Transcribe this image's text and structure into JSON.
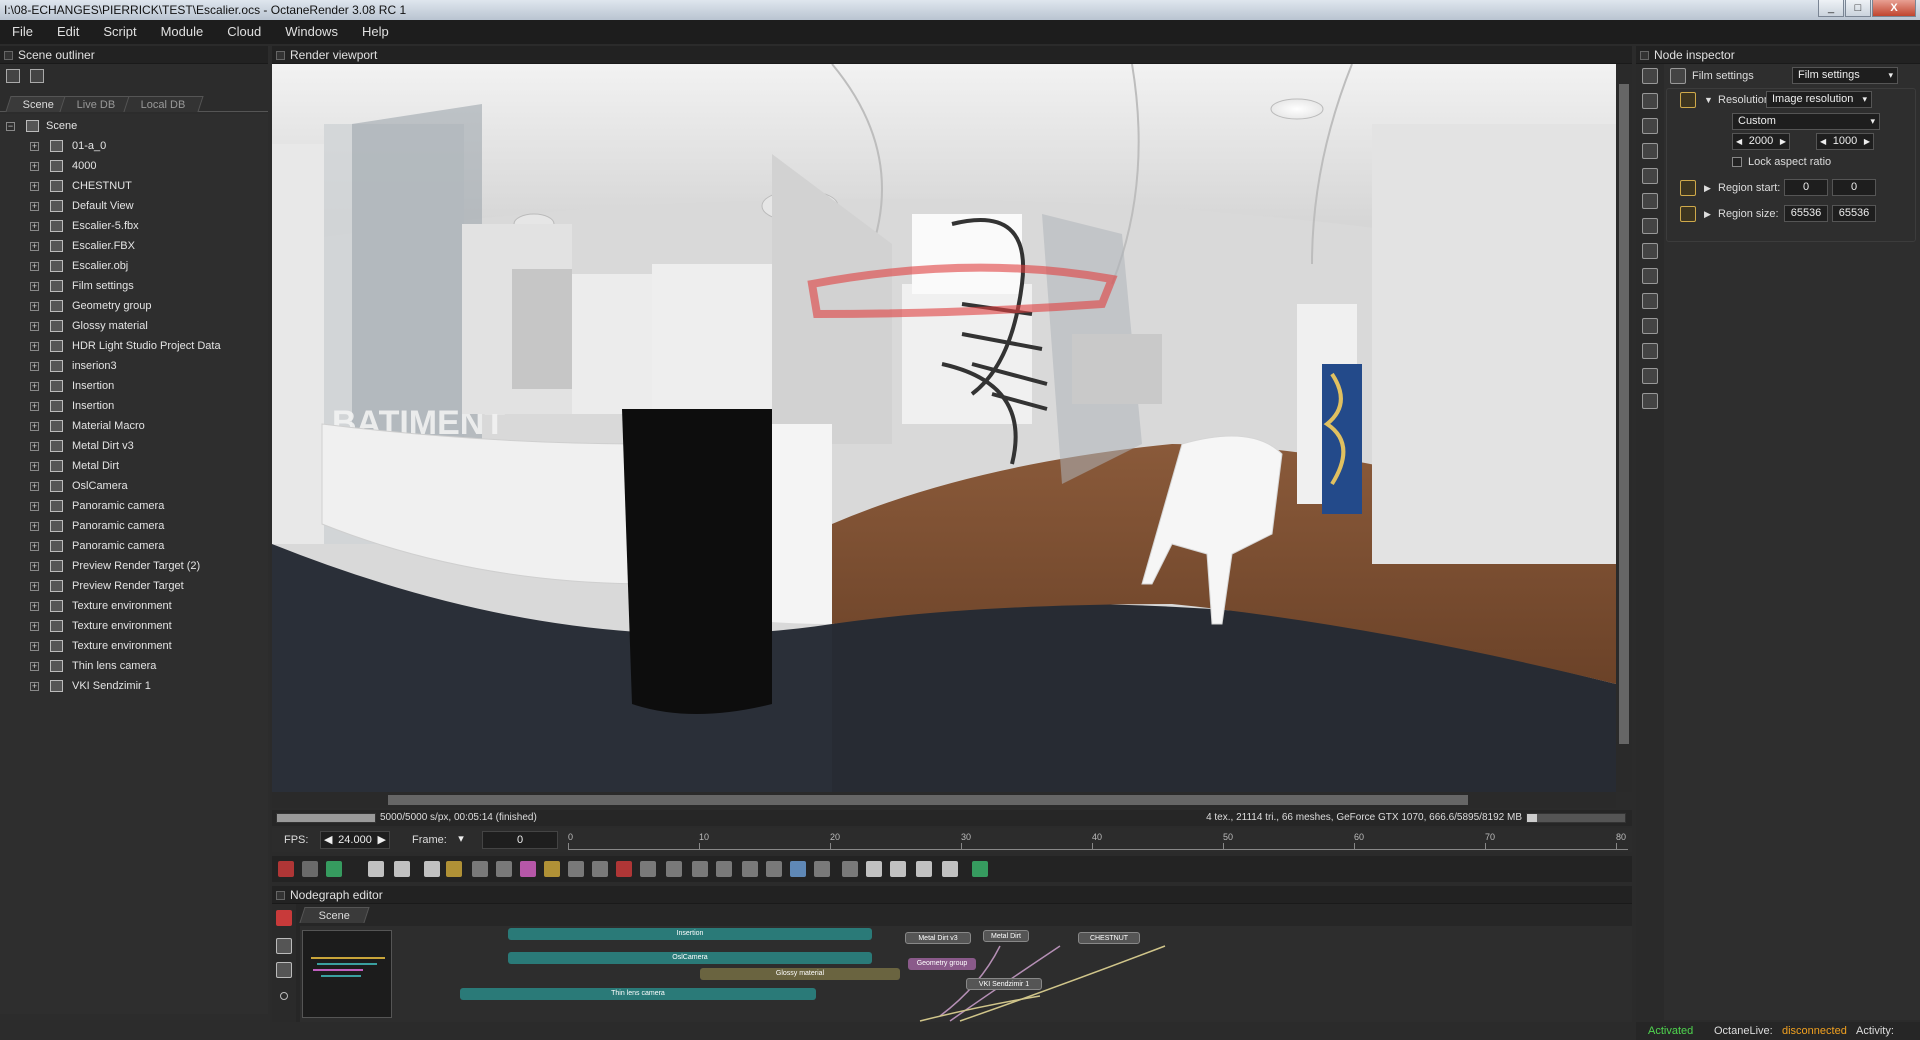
{
  "window": {
    "title": "I:\\08-ECHANGES\\PIERRICK\\TEST\\Escalier.ocs - OctaneRender 3.08 RC 1",
    "controls": [
      "_",
      "□",
      "X"
    ]
  },
  "menu": [
    "File",
    "Edit",
    "Script",
    "Module",
    "Cloud",
    "Windows",
    "Help"
  ],
  "outliner": {
    "title": "Scene outliner",
    "tabs": [
      "Scene",
      "Live DB",
      "Local DB"
    ],
    "root": "Scene",
    "items": [
      "01-a_0",
      "4000",
      "CHESTNUT",
      "Default View",
      "Escalier-5.fbx",
      "Escalier.FBX",
      "Escalier.obj",
      "Film settings",
      "Geometry group",
      "Glossy material",
      "HDR Light Studio Project Data",
      "inserion3",
      "Insertion",
      "Insertion",
      "Material Macro",
      "Metal Dirt v3",
      "Metal Dirt",
      "OslCamera",
      "Panoramic camera",
      "Panoramic camera",
      "Panoramic camera",
      "Preview Render Target (2)",
      "Preview Render Target",
      "Texture environment",
      "Texture environment",
      "Texture environment",
      "Thin lens camera",
      "VKI Sendzimir 1"
    ]
  },
  "viewport": {
    "title": "Render viewport",
    "status_left": "5000/5000 s/px, 00:05:14 (finished)",
    "status_right": "4 tex., 21114 tri., 66 meshes, GeForce GTX 1070, 666.6/5895/8192 MB",
    "progress": 1.0
  },
  "timeline": {
    "fps_label": "FPS:",
    "fps_value": "24.000",
    "frame_label": "Frame:",
    "frame_value": "0",
    "ticks": [
      "0",
      "10",
      "20",
      "30",
      "40",
      "50",
      "60",
      "70",
      "80"
    ]
  },
  "nodegraph": {
    "title": "Nodegraph editor",
    "tab": "Scene",
    "nodes": [
      "Insertion",
      "OslCamera",
      "Glossy material",
      "Thin lens camera",
      "Metal Dirt v3",
      "Metal Dirt",
      "CHESTNUT",
      "Geometry group",
      "VKI Sendzimir 1"
    ]
  },
  "inspector": {
    "title": "Node inspector",
    "node_label": "Film settings",
    "node_select": "Film settings",
    "resolution_label": "Resolution",
    "resolution_select": "Image resolution",
    "preset": "Custom",
    "width": "2000",
    "height": "1000",
    "lock_label": "Lock aspect ratio",
    "region_start_label": "Region start:",
    "region_start_x": "0",
    "region_start_y": "0",
    "region_size_label": "Region size:",
    "region_size_x": "65536",
    "region_size_y": "65536"
  },
  "statusbar": {
    "activated": "Activated",
    "live_label": "OctaneLive:",
    "live_value": "disconnected",
    "activity": "Activity:"
  }
}
